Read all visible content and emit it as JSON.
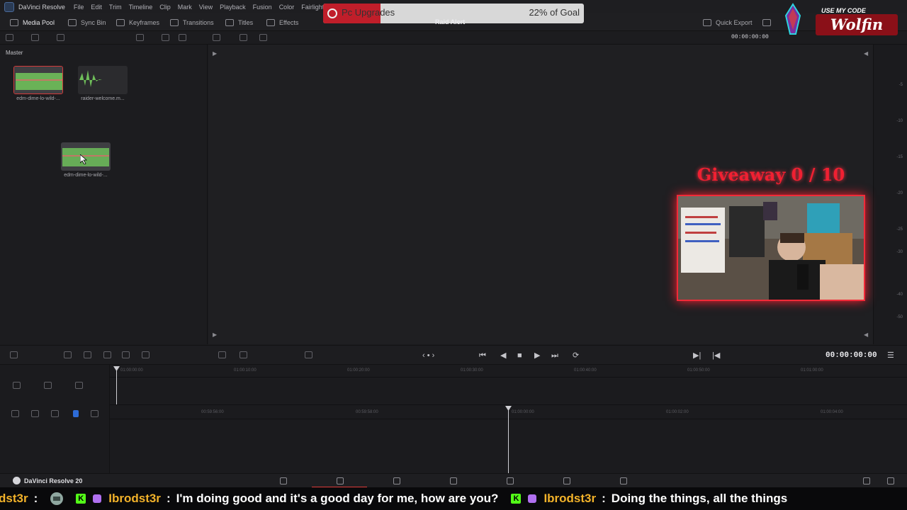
{
  "menubar": {
    "app_title": "DaVinci Resolve",
    "items": [
      "File",
      "Edit",
      "Trim",
      "Timeline",
      "Clip",
      "Mark",
      "View",
      "Playback",
      "Fusion",
      "Color",
      "Fairlight"
    ]
  },
  "toolbar": {
    "media_pool": "Media Pool",
    "sync_bin": "Sync Bin",
    "keyframes": "Keyframes",
    "transitions": "Transitions",
    "titles": "Titles",
    "effects": "Effects",
    "quick_export": "Quick Export",
    "source_timecode": "00:00:00:00"
  },
  "media_pool": {
    "bin_label": "Master",
    "clips": [
      {
        "name": "edm-dime-lo-wild-...",
        "selected": true
      },
      {
        "name": "raider-welcome.m...",
        "selected": false
      },
      {
        "name": "edm-dime-lo-wild-...",
        "selected": false
      }
    ]
  },
  "meters": {
    "ticks": [
      "-5",
      "-10",
      "-15",
      "-20",
      "-25",
      "-30",
      "-40",
      "-50"
    ]
  },
  "transport": {
    "timecode": "00:00:00:00"
  },
  "timeline": {
    "upper_ruler": [
      "01:00:00:00",
      "01:00:10:00",
      "01:00:20:00",
      "01:00:30:00",
      "01:00:40:00",
      "01:00:50:00",
      "01:01:00:00"
    ],
    "lower_ruler": [
      "00:59:56:00",
      "00:59:58:00",
      "01:00:00:00",
      "01:00:02:00",
      "01:00:04:00"
    ]
  },
  "pagebar": {
    "app_name": "DaVinci Resolve 20"
  },
  "overlay": {
    "goal_name": "Pc Upgrades",
    "goal_progress_label": "22% of Goal",
    "goal_progress": 0.22,
    "raid_alert": "Raid Alert",
    "code_prefix": "USE MY CODE",
    "code_name": "Wolfin",
    "giveaway": "Giveaway 0 / 10"
  },
  "chat": {
    "messages": [
      {
        "user": "Ibrodst3r",
        "text": "I'm doing good and it's a good day for me, how are you?"
      },
      {
        "user": "Ibrodst3r",
        "text": "Doing the things, all the things"
      }
    ],
    "leading_fragment": "dst3r"
  },
  "colors": {
    "accent_red": "#d43a3a",
    "chat_user": "#f2b22a",
    "kick_green": "#53fc18",
    "waveform_green": "#6fbf5a"
  }
}
